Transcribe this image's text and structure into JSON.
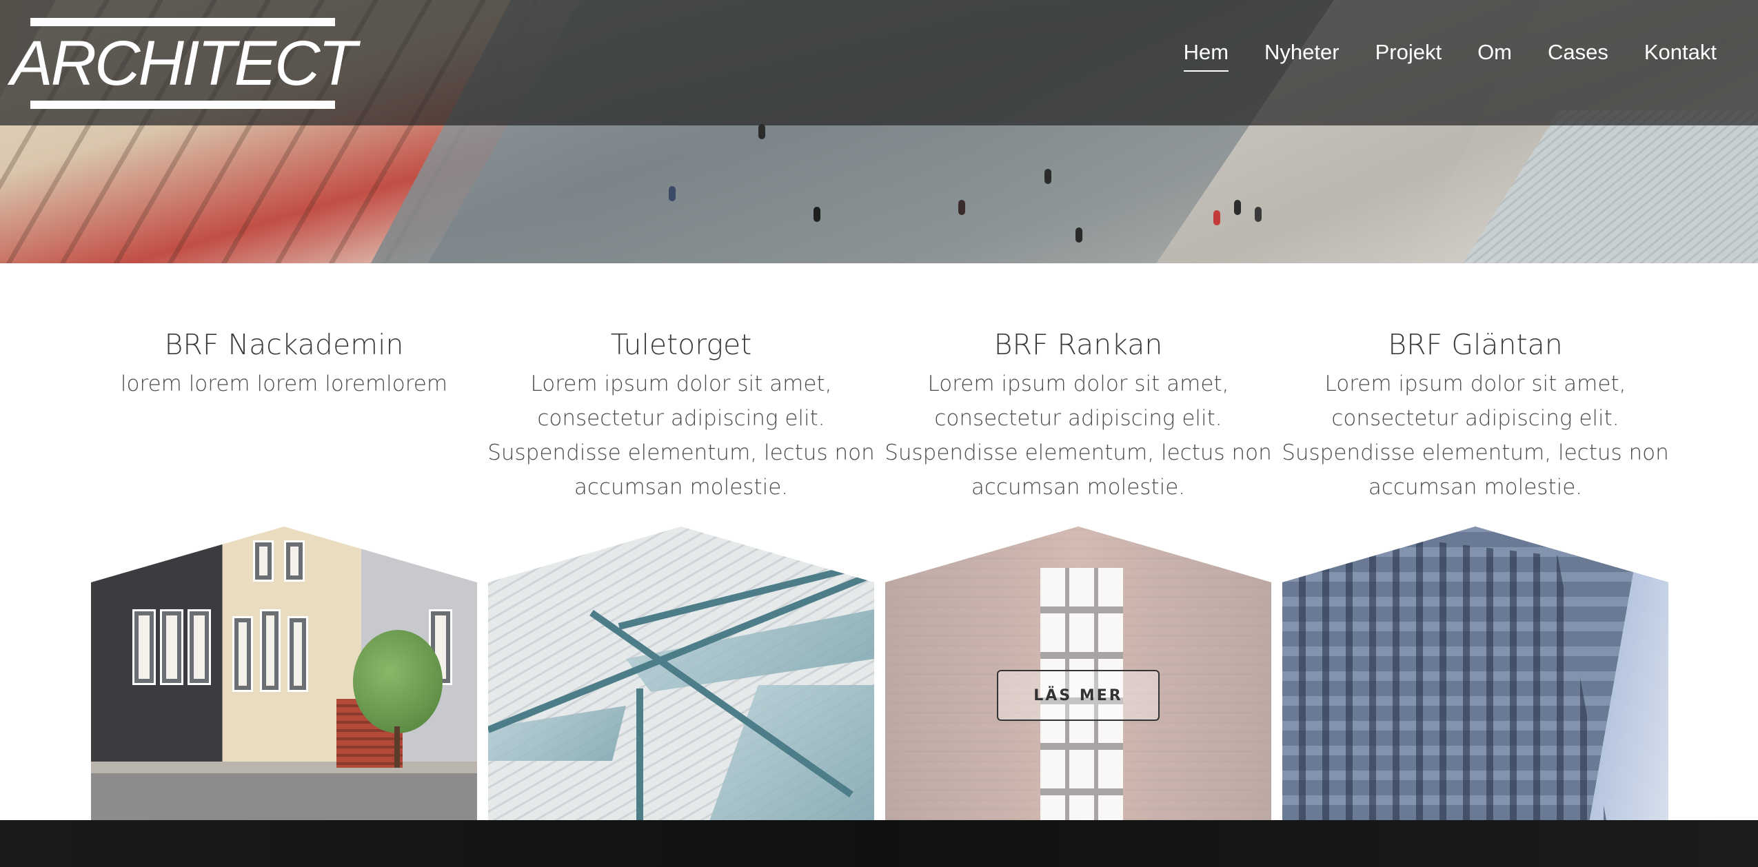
{
  "brand": {
    "logo_text": "ARCHITECT"
  },
  "nav": {
    "items": [
      {
        "label": "Hem",
        "active": true
      },
      {
        "label": "Nyheter",
        "active": false
      },
      {
        "label": "Projekt",
        "active": false
      },
      {
        "label": "Om",
        "active": false
      },
      {
        "label": "Cases",
        "active": false
      },
      {
        "label": "Kontakt",
        "active": false
      }
    ]
  },
  "projects": [
    {
      "title": "BRF Nackademin",
      "description": "lorem lorem lorem loremlorem",
      "image": "victorian-houses"
    },
    {
      "title": "Tuletorget",
      "description": "Lorem ipsum dolor sit amet, consectetur adipiscing elit. Suspendisse elementum, lectus non accumsan molestie.",
      "image": "glass-roof"
    },
    {
      "title": "BRF Rankan",
      "description": "Lorem ipsum dolor sit amet, consectetur adipiscing elit. Suspendisse elementum, lectus non accumsan molestie.",
      "image": "brick-facade",
      "button_label": "LÄS MER"
    },
    {
      "title": "BRF Gläntan",
      "description": "Lorem ipsum dolor sit amet, consectetur adipiscing elit. Suspendisse elementum, lectus non accumsan molestie.",
      "image": "tall-building"
    }
  ],
  "colors": {
    "navbar_bg": "#282828",
    "text_heading": "#3a3a3a",
    "text_body": "#4a4a4a",
    "button_border": "#333333"
  }
}
